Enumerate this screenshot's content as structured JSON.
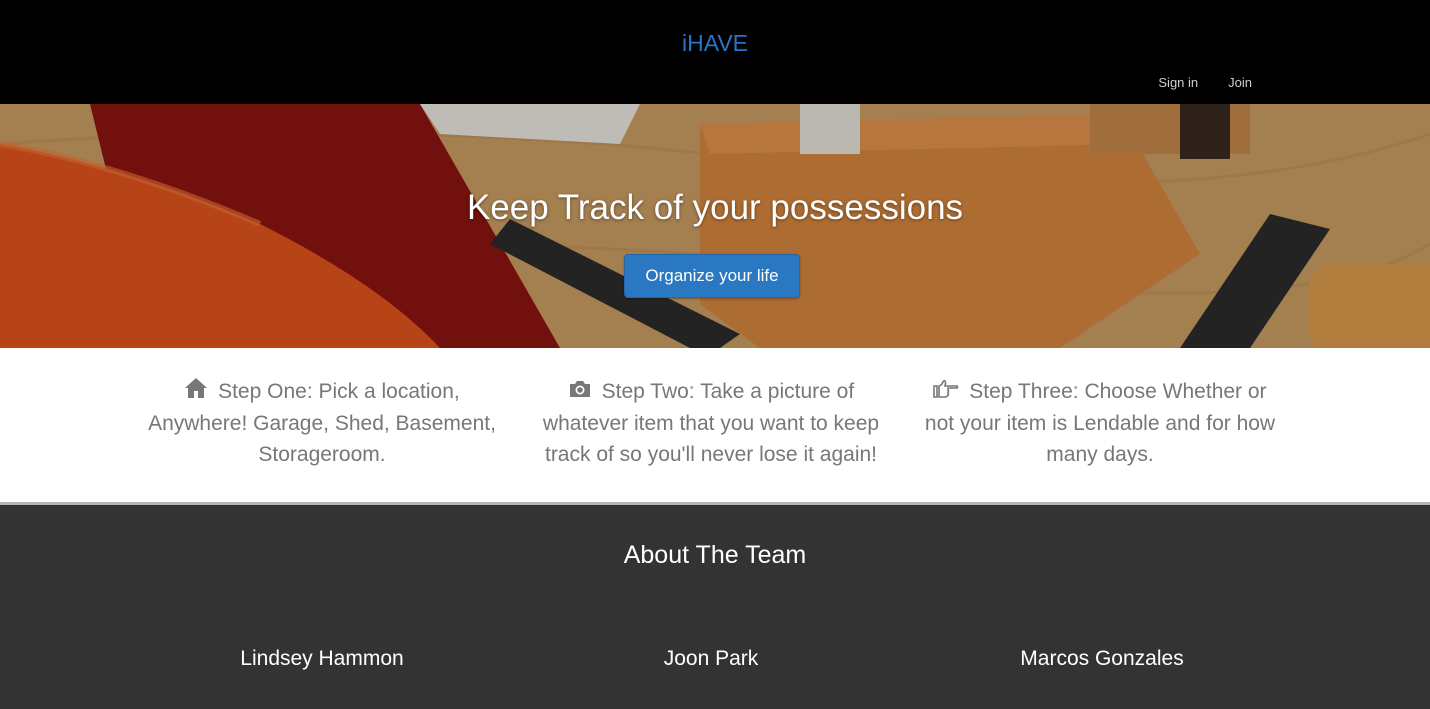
{
  "navbar": {
    "brand": "iHAVE",
    "links": [
      "Sign in",
      "Join"
    ]
  },
  "hero": {
    "title": "Keep Track of your possessions",
    "button_label": "Organize your life",
    "background_image": "wooden desk with orange chair, rulers and notebooks"
  },
  "steps": [
    {
      "icon": "home-icon",
      "text": "Step One: Pick a location, Anywhere! Garage, Shed, Basement, Storageroom."
    },
    {
      "icon": "camera-icon",
      "text": "Step Two: Take a picture of whatever item that you want to keep track of so you'll never lose it again!"
    },
    {
      "icon": "hand-pointing-icon",
      "text": "Step Three: Choose Whether or not your item is Lendable and for how many days."
    }
  ],
  "team": {
    "title": "About The Team",
    "members": [
      "Lindsey Hammon",
      "Joon Park",
      "Marcos Gonzales"
    ]
  },
  "colors": {
    "navbar_bg": "#000000",
    "brand": "#2a74c6",
    "button": "#2a78c2",
    "step_text": "#777777",
    "team_bg": "#333333"
  }
}
